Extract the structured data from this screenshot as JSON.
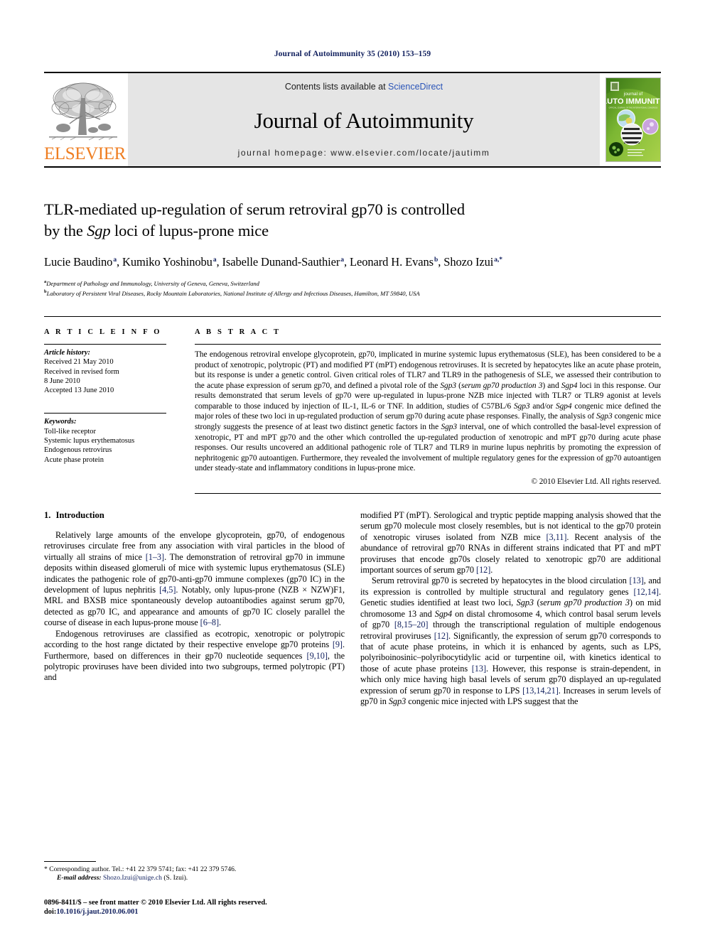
{
  "running_head": "Journal of Autoimmunity 35 (2010) 153–159",
  "masthead": {
    "publisher_name": "ELSEVIER",
    "contents_prefix": "Contents lists available at ",
    "sciencedirect": "ScienceDirect",
    "journal_title": "Journal of Autoimmunity",
    "homepage": "journal homepage: www.elsevier.com/locate/jautimm",
    "cover": {
      "line1": "journal of",
      "line2": "AUTO IMMUNITY",
      "tagline": "OFFICIAL JOURNAL OF THE INTERNATIONAL CONGRESS ON AUTOIMMUNITY",
      "accent_color": "#8cc63e",
      "dark_color": "#3e7a16"
    },
    "elsevier_orange": "#ef7e22",
    "banner_bg": "#e5e5e5",
    "link_blue": "#2b55b8"
  },
  "article": {
    "title_line1": "TLR-mediated up-regulation of serum retroviral gp70 is controlled",
    "title_line2_pre": "by the ",
    "title_line2_em": "Sgp",
    "title_line2_post": " loci of lupus-prone mice",
    "authors": [
      {
        "name": "Lucie Baudino",
        "sup": "a",
        "sep": ", "
      },
      {
        "name": "Kumiko Yoshinobu",
        "sup": "a",
        "sep": ", "
      },
      {
        "name": "Isabelle Dunand-Sauthier",
        "sup": "a",
        "sep": ", "
      },
      {
        "name": "Leonard H. Evans",
        "sup": "b",
        "sep": ", "
      },
      {
        "name": "Shozo Izui",
        "sup": "a,*",
        "sep": ""
      }
    ],
    "affiliation_a": "Department of Pathology and Immunology, University of Geneva, Geneva, Switzerland",
    "affiliation_b": "Laboratory of Persistent Viral Diseases, Rocky Mountain Laboratories, National Institute of Allergy and Infectious Diseases, Hamilton, MT 59840, USA"
  },
  "article_info": {
    "heading": "A R T I C L E  I N F O",
    "history_label": "Article history:",
    "history": [
      "Received 21 May 2010",
      "Received in revised form",
      "8 June 2010",
      "Accepted 13 June 2010"
    ],
    "keywords_label": "Keywords:",
    "keywords": [
      "Toll-like receptor",
      "Systemic lupus erythematosus",
      "Endogenous retrovirus",
      "Acute phase protein"
    ]
  },
  "abstract": {
    "heading": "A B S T R A C T",
    "p1": "The endogenous retroviral envelope glycoprotein, gp70, implicated in murine systemic lupus erythematosus (SLE), has been considered to be a product of xenotropic, polytropic (PT) and modified PT (mPT) endogenous retroviruses. It is secreted by hepatocytes like an acute phase protein, but its response is under a genetic control. Given critical roles of TLR7 and TLR9 in the pathogenesis of SLE, we assessed their contribution to the acute phase expression of serum gp70, and defined a pivotal role of the ",
    "em1": "Sgp3",
    "p2": " (",
    "em2": "serum gp70 production 3",
    "p3": ") and ",
    "em3": "Sgp4",
    "p4": " loci in this response. Our results demonstrated that serum levels of gp70 were up-regulated in lupus-prone NZB mice injected with TLR7 or TLR9 agonist at levels comparable to those induced by injection of IL-1, IL-6 or TNF. In addition, studies of C57BL/6 ",
    "em4": "Sgp3",
    "p5": " and/or ",
    "em5": "Sgp4",
    "p6": " congenic mice defined the major roles of these two loci in up-regulated production of serum gp70 during acute phase responses. Finally, the analysis of ",
    "em6": "Sgp3",
    "p7": " congenic mice strongly suggests the presence of at least two distinct genetic factors in the ",
    "em7": "Sgp3",
    "p8": " interval, one of which controlled the basal-level expression of xenotropic, PT and mPT gp70 and the other which controlled the up-regulated production of xenotropic and mPT gp70 during acute phase responses. Our results uncovered an additional pathogenic role of TLR7 and TLR9 in murine lupus nephritis by promoting the expression of nephritogenic gp70 autoantigen. Furthermore, they revealed the involvement of multiple regulatory genes for the expression of gp70 autoantigen under steady-state and inflammatory conditions in lupus-prone mice.",
    "copyright": "© 2010 Elsevier Ltd. All rights reserved."
  },
  "introduction": {
    "number": "1.",
    "title": "Introduction",
    "left_p1_a": "Relatively large amounts of the envelope glycoprotein, gp70, of endogenous retroviruses circulate free from any association with viral particles in the blood of virtually all strains of mice ",
    "left_p1_r1": "[1–3]",
    "left_p1_b": ". The demonstration of retroviral gp70 in immune deposits within diseased glomeruli of mice with systemic lupus erythematosus (SLE) indicates the pathogenic role of gp70-anti-gp70 immune complexes (gp70 IC) in the development of lupus nephritis ",
    "left_p1_r2": "[4,5]",
    "left_p1_c": ". Notably, only lupus-prone (NZB × NZW)F1, MRL and BXSB mice spontaneously develop autoantibodies against serum gp70, detected as gp70 IC, and appearance and amounts of gp70 IC closely parallel the course of disease in each lupus-prone mouse ",
    "left_p1_r3": "[6–8]",
    "left_p1_d": ".",
    "left_p2_a": "Endogenous retroviruses are classified as ecotropic, xenotropic or polytropic according to the host range dictated by their respective envelope gp70 proteins ",
    "left_p2_r1": "[9]",
    "left_p2_b": ". Furthermore, based on differences in their gp70 nucleotide sequences ",
    "left_p2_r2": "[9,10]",
    "left_p2_c": ", the polytropic proviruses have been divided into two subgroups, termed polytropic (PT) and",
    "right_p1_a": "modified PT (mPT). Serological and tryptic peptide mapping analysis showed that the serum gp70 molecule most closely resembles, but is not identical to the gp70 protein of xenotropic viruses isolated from NZB mice ",
    "right_p1_r1": "[3,11]",
    "right_p1_b": ". Recent analysis of the abundance of retroviral gp70 RNAs in different strains indicated that PT and mPT proviruses that encode gp70s closely related to xenotropic gp70 are additional important sources of serum gp70 ",
    "right_p1_r2": "[12]",
    "right_p1_c": ".",
    "right_p2_a": "Serum retroviral gp70 is secreted by hepatocytes in the blood circulation ",
    "right_p2_r1": "[13]",
    "right_p2_b": ", and its expression is controlled by multiple structural and regulatory genes ",
    "right_p2_r2": "[12,14]",
    "right_p2_c": ". Genetic studies identified at least two loci, ",
    "right_p2_em1": "Sgp3",
    "right_p2_d": " (",
    "right_p2_em2": "serum gp70 production 3",
    "right_p2_e": ") on mid chromosome 13 and ",
    "right_p2_em3": "Sgp4",
    "right_p2_f": " on distal chromosome 4, which control basal serum levels of gp70 ",
    "right_p2_r3": "[8,15–20]",
    "right_p2_g": " through the transcriptional regulation of multiple endogenous retroviral proviruses ",
    "right_p2_r4": "[12]",
    "right_p2_h": ". Significantly, the expression of serum gp70 corresponds to that of acute phase proteins, in which it is enhanced by agents, such as LPS, polyriboinosinic–polyribocytidylic acid or turpentine oil, with kinetics identical to those of acute phase proteins ",
    "right_p2_r5": "[13]",
    "right_p2_i": ". However, this response is strain-dependent, in which only mice having high basal levels of serum gp70 displayed an up-regulated expression of serum gp70 in response to LPS ",
    "right_p2_r6": "[13,14,21]",
    "right_p2_j": ". Increases in serum levels of gp70 in ",
    "right_p2_em4": "Sgp3",
    "right_p2_k": " congenic mice injected with LPS suggest that the"
  },
  "footnotes": {
    "corresponding_marker": "*",
    "corresponding": " Corresponding author. Tel.: +41 22 379 5741; fax: +41 22 379 5746.",
    "email_label": "E-mail address:",
    "email": "Shozo.Izui@unige.ch",
    "email_suffix": " (S. Izui).",
    "imprint": "0896-8411/$ – see front matter © 2010 Elsevier Ltd. All rights reserved.",
    "doi_label": "doi:",
    "doi": "10.1016/j.jaut.2010.06.001"
  }
}
